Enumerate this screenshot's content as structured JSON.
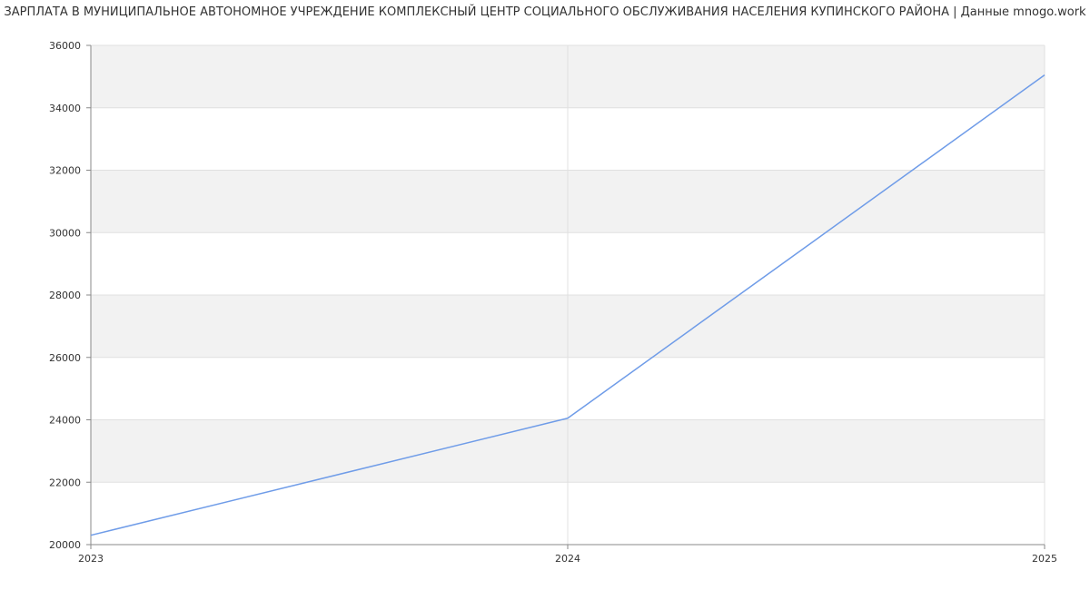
{
  "chart_data": {
    "type": "line",
    "title": "ЗАРПЛАТА В МУНИЦИПАЛЬНОЕ АВТОНОМНОЕ УЧРЕЖДЕНИЕ КОМПЛЕКСНЫЙ ЦЕНТР СОЦИАЛЬНОГО ОБСЛУЖИВАНИЯ НАСЕЛЕНИЯ КУПИНСКОГО РАЙОНА | Данные mnogo.work",
    "xlabel": "",
    "ylabel": "",
    "x": [
      "2023",
      "2024",
      "2025"
    ],
    "series": [
      {
        "values": [
          20300,
          24050,
          35050
        ]
      }
    ],
    "ylim": [
      20000,
      36000
    ],
    "yticks": [
      20000,
      22000,
      24000,
      26000,
      28000,
      30000,
      32000,
      34000,
      36000
    ],
    "grid": true,
    "band_color": "#f2f2f2",
    "line_color": "#6f9ce8",
    "grid_color": "#e0e0e0",
    "axis_color": "#888888"
  }
}
